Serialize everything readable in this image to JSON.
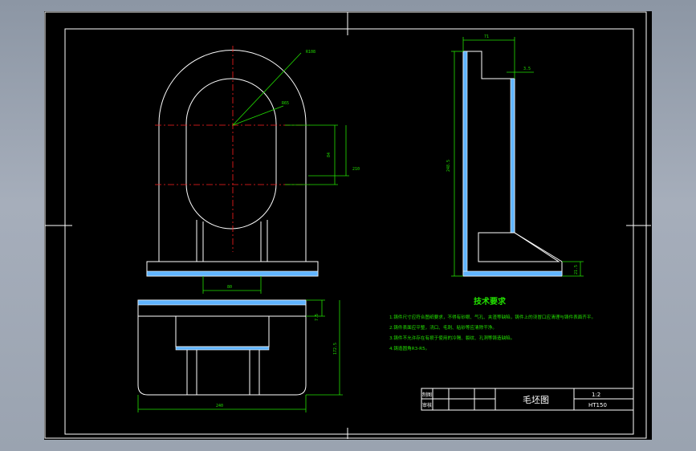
{
  "drawing": {
    "technical_requirements": {
      "title": "技术要求",
      "items": [
        "1.铸件尺寸应符合图纸要求，不得有砂眼、气孔、夹渣等缺陷，铸件上的浇冒口应清理与铸件表面齐平。",
        "2.铸件表面应平整，浇口、毛刺、粘砂等应清除干净。",
        "3.铸件不允许存在有损于使用的冷隔、裂纹、孔洞等铸造缺陷。",
        "4.铸造圆角R3-R5。"
      ]
    },
    "title_block": {
      "name": "毛坯图",
      "scale": "1:2",
      "material": "HT150",
      "drawn_by": "制图",
      "checked_by": "审核"
    },
    "dimensions": {
      "front_radius_outer": "R108",
      "front_radius_inner": "R65",
      "front_height_inner": "84",
      "front_height_total": "210",
      "front_base_width": "80",
      "top_height_flange": "7.5",
      "top_height_total": "172.5",
      "top_width": "240",
      "side_width_top": "71",
      "side_step": "3.5",
      "side_height": "248.5",
      "side_base_height": "21.5"
    }
  }
}
